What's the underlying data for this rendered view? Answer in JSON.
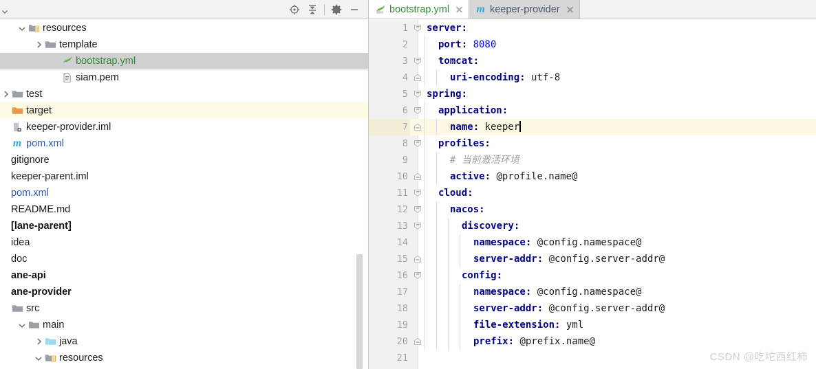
{
  "project_panel": {
    "toolbar": {
      "buttons": [
        {
          "name": "locate-icon",
          "title": "Select Opened File"
        },
        {
          "name": "collapse-all-icon",
          "title": "Collapse All"
        },
        {
          "name": "gear-icon",
          "title": "Settings"
        },
        {
          "name": "minimize-icon",
          "title": "Hide"
        }
      ]
    },
    "tree": [
      {
        "label": "resources",
        "indent": 1,
        "chevron": "down",
        "icon": "resources-folder-icon",
        "style": "",
        "row": ""
      },
      {
        "label": "template",
        "indent": 2,
        "chevron": "right",
        "icon": "folder-icon",
        "style": "",
        "row": ""
      },
      {
        "label": "bootstrap.yml",
        "indent": 3,
        "chevron": "none",
        "icon": "spring-yaml-icon",
        "style": "green",
        "row": "sel"
      },
      {
        "label": "siam.pem",
        "indent": 3,
        "chevron": "none",
        "icon": "text-file-icon",
        "style": "",
        "row": ""
      },
      {
        "label": "test",
        "indent": 0,
        "chevron": "right",
        "icon": "folder-icon",
        "style": "",
        "row": ""
      },
      {
        "label": "target",
        "indent": 0,
        "chevron": "none",
        "icon": "excluded-folder-icon",
        "style": "",
        "row": "excluded"
      },
      {
        "label": "keeper-provider.iml",
        "indent": -1,
        "chevron": "none",
        "icon": "iml-file-icon",
        "style": "",
        "row": ""
      },
      {
        "label": "pom.xml",
        "indent": -1,
        "chevron": "none",
        "icon": "maven-m-icon",
        "style": "blue",
        "row": ""
      },
      {
        "label": "gitignore",
        "indent": -2,
        "chevron": "none",
        "icon": "none",
        "style": "",
        "row": ""
      },
      {
        "label": "keeper-parent.iml",
        "indent": -2,
        "chevron": "none",
        "icon": "none",
        "style": "",
        "row": ""
      },
      {
        "label": "pom.xml",
        "indent": -2,
        "chevron": "none",
        "icon": "none",
        "style": "blue",
        "row": ""
      },
      {
        "label": "README.md",
        "indent": -2,
        "chevron": "none",
        "icon": "none",
        "style": "",
        "row": ""
      },
      {
        "label": "[lane-parent]",
        "indent": -2,
        "chevron": "none",
        "icon": "none",
        "style": "bold",
        "row": ""
      },
      {
        "label": "idea",
        "indent": -2,
        "chevron": "none",
        "icon": "none",
        "style": "",
        "row": ""
      },
      {
        "label": "doc",
        "indent": -2,
        "chevron": "none",
        "icon": "none",
        "style": "",
        "row": ""
      },
      {
        "label": "ane-api",
        "indent": -2,
        "chevron": "none",
        "icon": "none",
        "style": "bold",
        "row": ""
      },
      {
        "label": "ane-provider",
        "indent": -2,
        "chevron": "none",
        "icon": "none",
        "style": "bold",
        "row": ""
      },
      {
        "label": "src",
        "indent": 0,
        "chevron": "none",
        "icon": "folder-icon",
        "style": "",
        "row": ""
      },
      {
        "label": "main",
        "indent": 1,
        "chevron": "down",
        "icon": "folder-icon",
        "style": "",
        "row": ""
      },
      {
        "label": "java",
        "indent": 2,
        "chevron": "right",
        "icon": "sources-folder-icon",
        "style": "",
        "row": ""
      },
      {
        "label": "resources",
        "indent": 2,
        "chevron": "down",
        "icon": "resources-folder-icon",
        "style": "",
        "row": ""
      }
    ]
  },
  "editor": {
    "tabs": [
      {
        "label": "bootstrap.yml",
        "icon": "spring-yaml-icon",
        "state": "active",
        "text_style": "green",
        "close": "close-icon"
      },
      {
        "label": "keeper-provider",
        "icon": "maven-m-icon",
        "state": "inactive",
        "text_style": "grayblue",
        "close": "close-icon"
      }
    ],
    "lines": [
      {
        "n": "1",
        "indent": 0,
        "fold": "collapse",
        "segs": [
          {
            "t": "server:",
            "c": "k"
          }
        ]
      },
      {
        "n": "2",
        "indent": 1,
        "fold": "none",
        "segs": [
          {
            "t": "port: ",
            "c": "k"
          },
          {
            "t": "8080",
            "c": "num"
          }
        ]
      },
      {
        "n": "3",
        "indent": 1,
        "fold": "collapse",
        "segs": [
          {
            "t": "tomcat:",
            "c": "k"
          }
        ]
      },
      {
        "n": "4",
        "indent": 2,
        "fold": "end",
        "segs": [
          {
            "t": "uri-encoding: ",
            "c": "k"
          },
          {
            "t": "utf-8",
            "c": "val"
          }
        ]
      },
      {
        "n": "5",
        "indent": 0,
        "fold": "collapse",
        "segs": [
          {
            "t": "spring:",
            "c": "k"
          }
        ]
      },
      {
        "n": "6",
        "indent": 1,
        "fold": "collapse",
        "segs": [
          {
            "t": "application:",
            "c": "k"
          }
        ]
      },
      {
        "n": "7",
        "indent": 2,
        "fold": "end",
        "cursor": true,
        "segs": [
          {
            "t": "name: ",
            "c": "k"
          },
          {
            "t": "keeper",
            "c": "val"
          }
        ]
      },
      {
        "n": "8",
        "indent": 1,
        "fold": "collapse",
        "segs": [
          {
            "t": "profiles:",
            "c": "k"
          }
        ]
      },
      {
        "n": "9",
        "indent": 2,
        "fold": "none",
        "segs": [
          {
            "t": "# 当前激活环境",
            "c": "cmt"
          }
        ]
      },
      {
        "n": "10",
        "indent": 2,
        "fold": "end",
        "segs": [
          {
            "t": "active: ",
            "c": "k"
          },
          {
            "t": "@profile.name@",
            "c": "val"
          }
        ]
      },
      {
        "n": "11",
        "indent": 1,
        "fold": "collapse",
        "segs": [
          {
            "t": "cloud:",
            "c": "k"
          }
        ]
      },
      {
        "n": "12",
        "indent": 2,
        "fold": "collapse",
        "segs": [
          {
            "t": "nacos:",
            "c": "k"
          }
        ]
      },
      {
        "n": "13",
        "indent": 3,
        "fold": "collapse",
        "segs": [
          {
            "t": "discovery:",
            "c": "k"
          }
        ]
      },
      {
        "n": "14",
        "indent": 4,
        "fold": "none",
        "segs": [
          {
            "t": "namespace: ",
            "c": "k"
          },
          {
            "t": "@config.namespace@",
            "c": "val"
          }
        ]
      },
      {
        "n": "15",
        "indent": 4,
        "fold": "end",
        "segs": [
          {
            "t": "server-addr: ",
            "c": "k"
          },
          {
            "t": "@config.server-addr@",
            "c": "val"
          }
        ]
      },
      {
        "n": "16",
        "indent": 3,
        "fold": "collapse",
        "segs": [
          {
            "t": "config:",
            "c": "k"
          }
        ]
      },
      {
        "n": "17",
        "indent": 4,
        "fold": "none",
        "segs": [
          {
            "t": "namespace: ",
            "c": "k"
          },
          {
            "t": "@config.namespace@",
            "c": "val"
          }
        ]
      },
      {
        "n": "18",
        "indent": 4,
        "fold": "none",
        "segs": [
          {
            "t": "server-addr: ",
            "c": "k"
          },
          {
            "t": "@config.server-addr@",
            "c": "val"
          }
        ]
      },
      {
        "n": "19",
        "indent": 4,
        "fold": "none",
        "segs": [
          {
            "t": "file-extension: ",
            "c": "k"
          },
          {
            "t": "yml",
            "c": "val"
          }
        ]
      },
      {
        "n": "20",
        "indent": 4,
        "fold": "end",
        "segs": [
          {
            "t": "prefix: ",
            "c": "k"
          },
          {
            "t": "@prefix.name@",
            "c": "val"
          }
        ]
      },
      {
        "n": "21",
        "indent": 0,
        "fold": "none",
        "segs": []
      }
    ]
  },
  "watermark": {
    "text": "CSDN @吃坨西红柿"
  },
  "colors": {
    "selection": "#d0d0d0",
    "excluded_row": "#fdfbe4",
    "cursor_line": "#fcf8e4",
    "yaml_key": "#000080",
    "yaml_number": "#0000ff",
    "comment": "#a0a0a0",
    "green_file": "#2f8a33",
    "blue_file": "#2b57b5",
    "maven_cyan": "#2eaadc",
    "toolbar_bg": "#f2f2f2",
    "gutter_bg": "#f1f1f1"
  }
}
